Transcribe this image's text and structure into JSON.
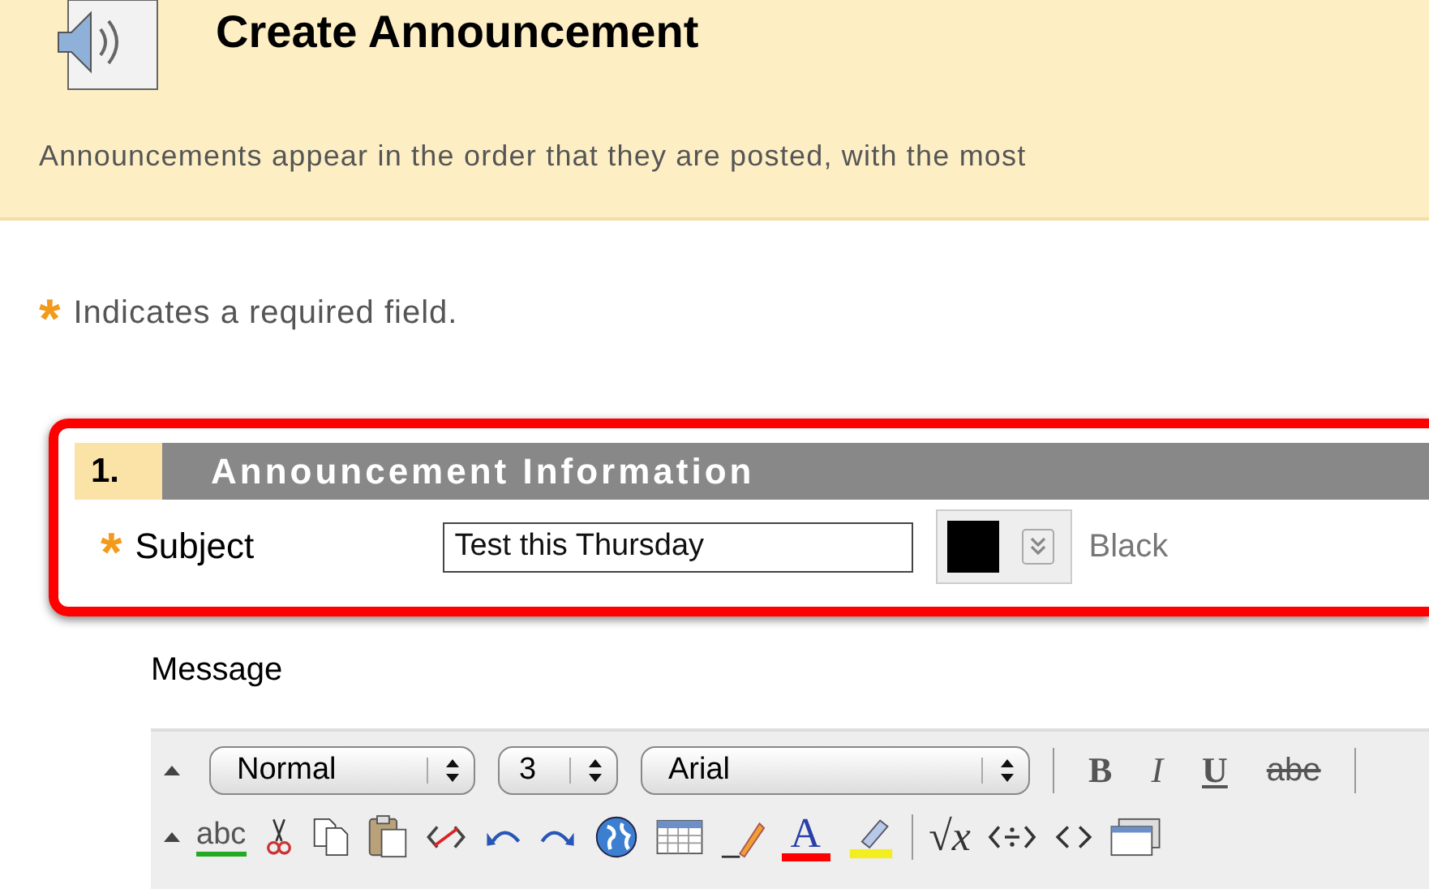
{
  "header": {
    "title": "Create Announcement",
    "description": "Announcements appear in the order that they are posted, with the most"
  },
  "required_note": {
    "marker": "*",
    "text": "Indicates a required field."
  },
  "section": {
    "number": "1.",
    "title": "Announcement Information",
    "highlighted": true
  },
  "subject": {
    "required": true,
    "marker": "*",
    "label": "Subject",
    "value": "Test this Thursday",
    "color": "#000000",
    "color_label": "Black"
  },
  "message": {
    "label": "Message"
  },
  "toolbar": {
    "selects": [
      {
        "value": "Normal"
      },
      {
        "value": "3"
      },
      {
        "value": "Arial"
      }
    ],
    "format_buttons": [
      {
        "label": "B",
        "kind": "bold"
      },
      {
        "label": "I",
        "kind": "italic"
      },
      {
        "label": "U",
        "kind": "underline"
      },
      {
        "label": "abe",
        "kind": "strike"
      }
    ],
    "spellcheck": "abc",
    "font_color": "A",
    "math": "√x"
  }
}
